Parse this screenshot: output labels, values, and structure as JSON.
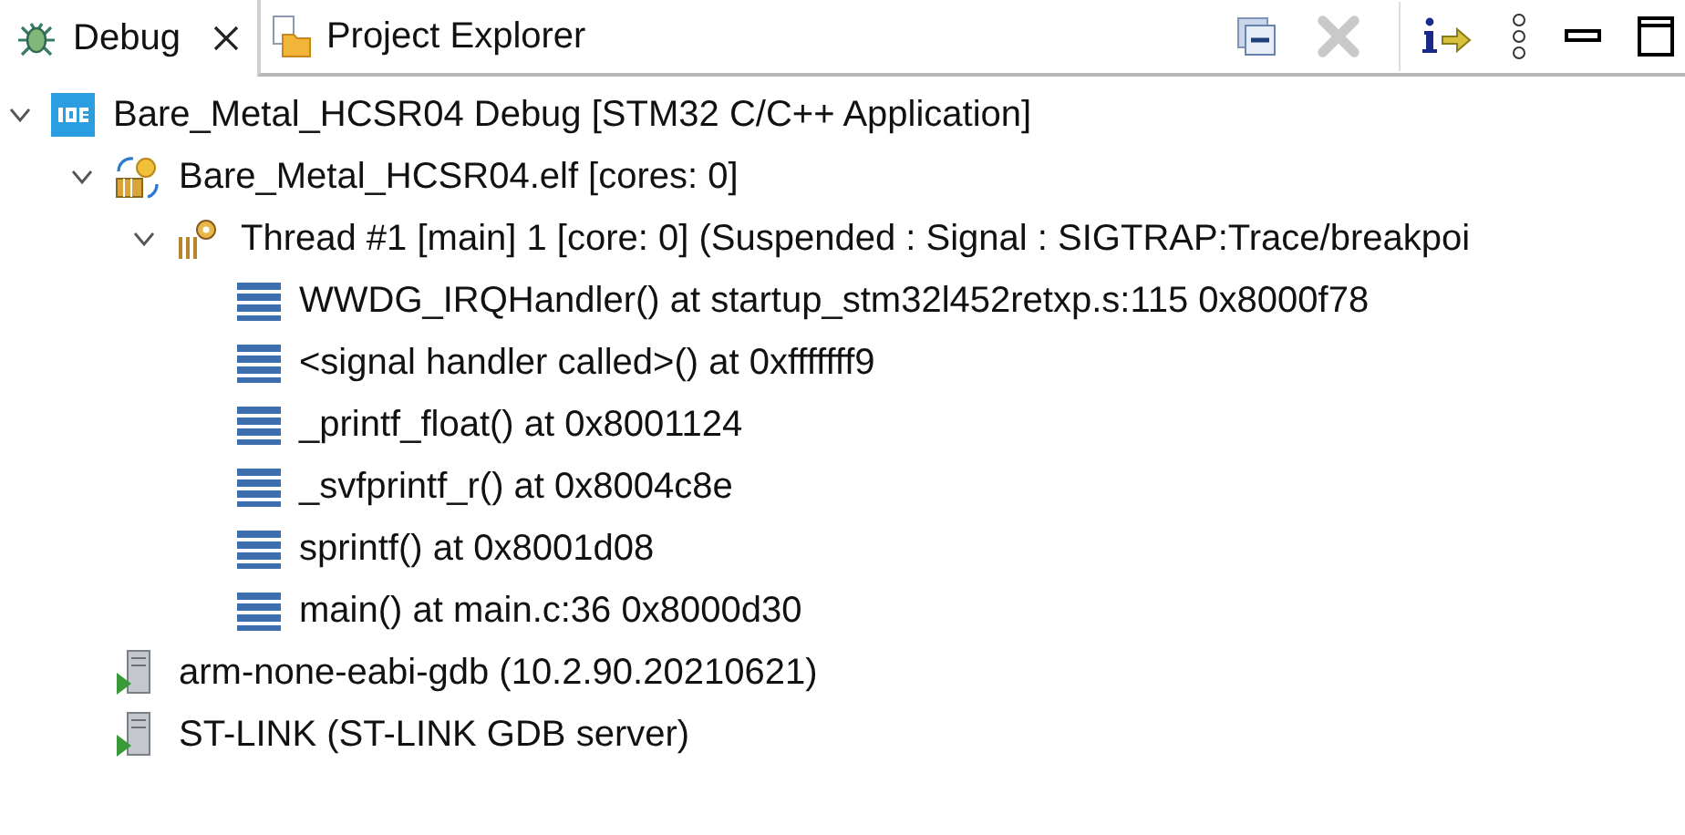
{
  "tabs": [
    {
      "label": "Debug",
      "kind": "debug",
      "selected": true,
      "closable": true
    },
    {
      "label": "Project Explorer",
      "kind": "explorer",
      "selected": false,
      "closable": false
    }
  ],
  "toolbar": [
    {
      "kind": "collapse",
      "disabled": false
    },
    {
      "kind": "remove",
      "disabled": true
    },
    {
      "kind": "info",
      "disabled": false
    },
    {
      "kind": "menu",
      "disabled": false
    },
    {
      "kind": "minimize",
      "disabled": false
    },
    {
      "kind": "maximize",
      "disabled": false
    }
  ],
  "tree": [
    {
      "label": "Bare_Metal_HCSR04 Debug [STM32 C/C++ Application]",
      "kind": "launch",
      "expanded": true,
      "children": [
        {
          "label": "Bare_Metal_HCSR04.elf [cores: 0]",
          "kind": "elf",
          "expanded": true,
          "children": [
            {
              "label": "Thread #1 [main] 1 [core: 0] (Suspended : Signal : SIGTRAP:Trace/breakpoi",
              "kind": "thread",
              "expanded": true,
              "children": [
                {
                  "label": "WWDG_IRQHandler() at startup_stm32l452retxp.s:115 0x8000f78",
                  "kind": "frame"
                },
                {
                  "label": "<signal handler called>() at 0xfffffff9",
                  "kind": "frame"
                },
                {
                  "label": "_printf_float() at 0x8001124",
                  "kind": "frame"
                },
                {
                  "label": "_svfprintf_r() at 0x8004c8e",
                  "kind": "frame"
                },
                {
                  "label": "sprintf() at 0x8001d08",
                  "kind": "frame"
                },
                {
                  "label": "main() at main.c:36 0x8000d30",
                  "kind": "frame"
                }
              ]
            }
          ]
        },
        {
          "label": "arm-none-eabi-gdb (10.2.90.20210621)",
          "kind": "process"
        },
        {
          "label": "ST-LINK (ST-LINK GDB server)",
          "kind": "process"
        }
      ]
    }
  ]
}
